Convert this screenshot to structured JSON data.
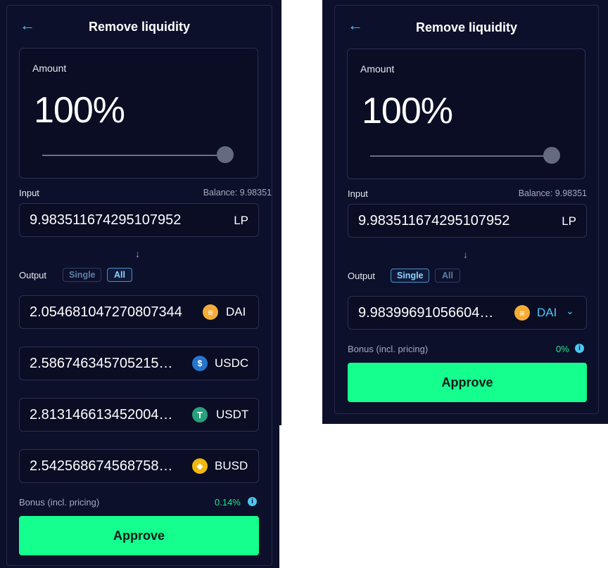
{
  "colors": {
    "background": "#0d102b",
    "accent": "#4cc7f2",
    "approve": "#15ff8f",
    "bonus": "#19e890"
  },
  "left": {
    "title": "Remove liquidity",
    "amount_label": "Amount",
    "amount_value": "100%",
    "slider_fraction": 1.0,
    "input_label": "Input",
    "balance": "Balance: 9.98351",
    "input_value": "9.983511674295107952",
    "input_suffix": "LP",
    "output_label": "Output",
    "toggle_single": "Single",
    "toggle_all": "All",
    "selected_output_mode": "All",
    "outputs": [
      {
        "value": "2.054681047270807344",
        "symbol": "DAI",
        "icon": "dai-icon"
      },
      {
        "value": "2.586746345705215…",
        "symbol": "USDC",
        "icon": "usdc-icon"
      },
      {
        "value": "2.813146613452004…",
        "symbol": "USDT",
        "icon": "usdt-icon"
      },
      {
        "value": "2.542568674568758…",
        "symbol": "BUSD",
        "icon": "busd-icon"
      }
    ],
    "bonus_label": "Bonus (incl. pricing)",
    "bonus_value": "0.14%",
    "approve_label": "Approve"
  },
  "right": {
    "title": "Remove liquidity",
    "amount_label": "Amount",
    "amount_value": "100%",
    "slider_fraction": 1.0,
    "input_label": "Input",
    "balance": "Balance: 9.98351",
    "input_value": "9.983511674295107952",
    "input_suffix": "LP",
    "output_label": "Output",
    "toggle_single": "Single",
    "toggle_all": "All",
    "selected_output_mode": "Single",
    "output": {
      "value": "9.98399691056604…",
      "symbol": "DAI",
      "icon": "dai-icon"
    },
    "bonus_label": "Bonus (incl. pricing)",
    "bonus_value": "0%",
    "approve_label": "Approve"
  }
}
